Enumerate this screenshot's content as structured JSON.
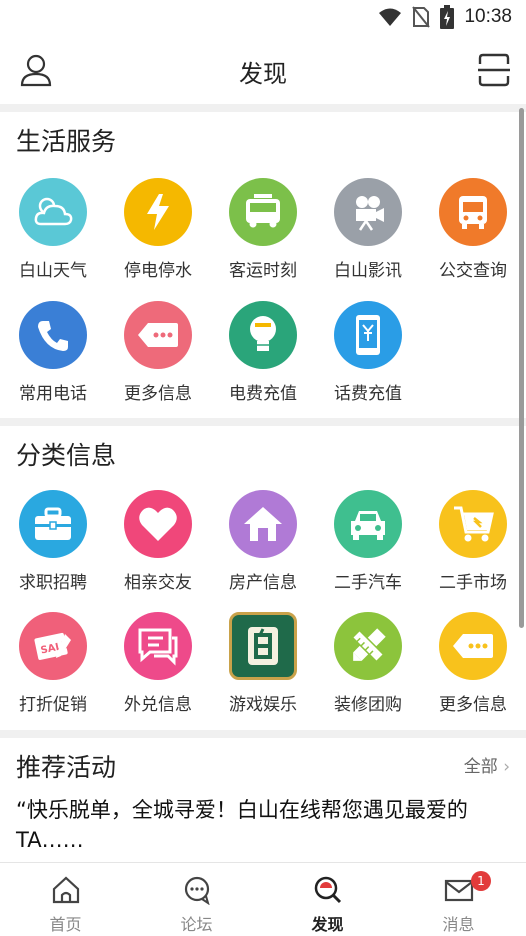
{
  "status_bar": {
    "time": "10:38",
    "icons": [
      "wifi-icon",
      "no-sim-icon",
      "battery-charging-icon"
    ]
  },
  "header": {
    "title": "发现",
    "left_icon": "user-icon",
    "right_icon": "scan-icon"
  },
  "life_services": {
    "title": "生活服务",
    "items": [
      {
        "label": "白山天气",
        "icon": "weather-icon",
        "color": "#5ac8d6"
      },
      {
        "label": "停电停水",
        "icon": "lightning-icon",
        "color": "#f5b800"
      },
      {
        "label": "客运时刻",
        "icon": "coach-bus-icon",
        "color": "#7cc04a"
      },
      {
        "label": "白山影讯",
        "icon": "film-camera-icon",
        "color": "#9aa0a8"
      },
      {
        "label": "公交查询",
        "icon": "bus-icon",
        "color": "#f07a2a"
      },
      {
        "label": "常用电话",
        "icon": "phone-icon",
        "color": "#3a7fd6"
      },
      {
        "label": "更多信息",
        "icon": "more-tag-icon",
        "color": "#ee6a7a"
      },
      {
        "label": "电费充值",
        "icon": "bulb-icon",
        "color": "#2aa57a"
      },
      {
        "label": "话费充值",
        "icon": "mobile-recharge-icon",
        "color": "#2a9de6"
      }
    ]
  },
  "classified": {
    "title": "分类信息",
    "items": [
      {
        "label": "求职招聘",
        "icon": "briefcase-icon",
        "color": "#2aa8e0"
      },
      {
        "label": "相亲交友",
        "icon": "heart-icon",
        "color": "#f0477a"
      },
      {
        "label": "房产信息",
        "icon": "house-icon",
        "color": "#b07ad6"
      },
      {
        "label": "二手汽车",
        "icon": "car-icon",
        "color": "#3fbf8f"
      },
      {
        "label": "二手市场",
        "icon": "cart-icon",
        "color": "#f8c21c"
      },
      {
        "label": "打折促销",
        "icon": "sale-tag-icon",
        "color": "#f0607a"
      },
      {
        "label": "外兑信息",
        "icon": "chat-icon",
        "color": "#ee4a8a"
      },
      {
        "label": "游戏娱乐",
        "icon": "mahjong-icon",
        "color": "#1f6a4a"
      },
      {
        "label": "装修团购",
        "icon": "pencil-ruler-icon",
        "color": "#8cc43c"
      },
      {
        "label": "更多信息",
        "icon": "more-tag-icon",
        "color": "#f8c21c"
      }
    ]
  },
  "recommended": {
    "title": "推荐活动",
    "more_label": "全部",
    "activity_text": "“快乐脱单，全城寻爱！白山在线帮您遇见最爱的TA……"
  },
  "tabs": [
    {
      "label": "首页",
      "icon": "home-icon",
      "active": false
    },
    {
      "label": "论坛",
      "icon": "forum-icon",
      "active": false
    },
    {
      "label": "发现",
      "icon": "discover-icon",
      "active": true
    },
    {
      "label": "消息",
      "icon": "message-icon",
      "active": false,
      "badge": "1"
    }
  ]
}
